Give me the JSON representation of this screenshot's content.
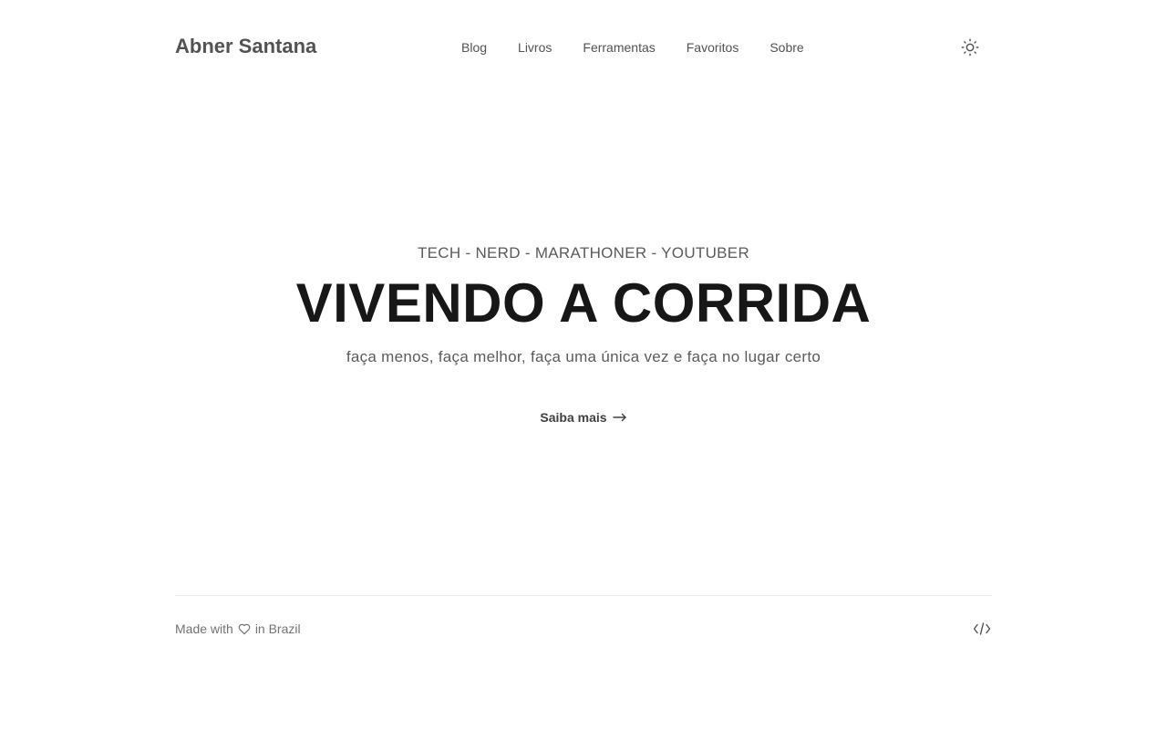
{
  "header": {
    "site_title": "Abner Santana",
    "nav": [
      {
        "label": "Blog"
      },
      {
        "label": "Livros"
      },
      {
        "label": "Ferramentas"
      },
      {
        "label": "Favoritos"
      },
      {
        "label": "Sobre"
      }
    ],
    "theme_toggle_icon": "sun-icon"
  },
  "hero": {
    "tagline": "TECH - NERD - MARATHONER - YOUTUBER",
    "title": "VIVENDO A CORRIDA",
    "subtitle": "faça menos, faça melhor, faça uma única vez e faça no lugar certo",
    "cta_label": "Saiba mais",
    "cta_icon": "arrow-right-icon"
  },
  "footer": {
    "made_with": "Made with",
    "heart_icon": "heart-icon",
    "in_location": "in Brazil",
    "source_icon": "code-icon"
  },
  "colors": {
    "text_primary": "#171717",
    "text_secondary": "#525252",
    "text_muted": "#737373",
    "background": "#ffffff"
  }
}
